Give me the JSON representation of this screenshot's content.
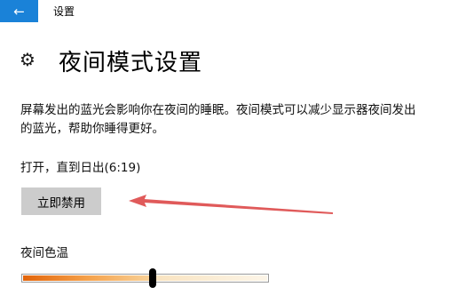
{
  "app": {
    "title": "设置",
    "back_icon": "back-arrow-icon",
    "accent_color": "#1a82d8"
  },
  "page": {
    "title": "夜间模式设置",
    "icon": "gear-icon"
  },
  "description": "屏幕发出的蓝光会影响你在夜间的睡眠。夜间模式可以减少显示器夜间发出的蓝光，帮助你睡得更好。",
  "status_text": "打开，直到日出(6:19)",
  "disable_button_label": "立即禁用",
  "annotation_arrow_color": "#e05a5a",
  "color_temperature": {
    "label": "夜间色温",
    "level": 0.53
  }
}
